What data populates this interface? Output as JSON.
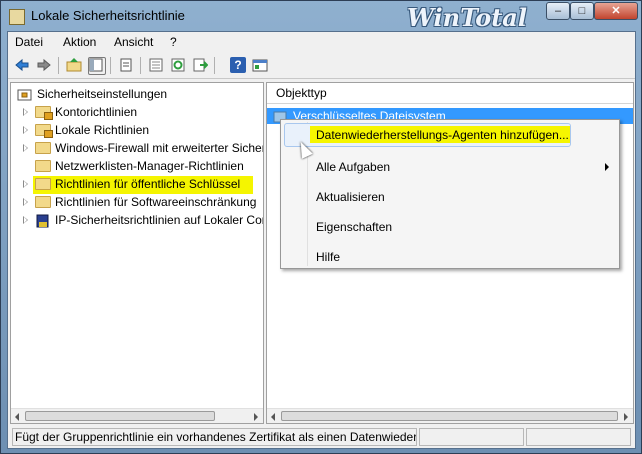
{
  "window": {
    "title": "Lokale Sicherheitsrichtlinie",
    "watermark": "WinTotal",
    "controls": {
      "minimize": "–",
      "maximize": "□",
      "close": "✕"
    }
  },
  "menu": [
    "Datei",
    "Aktion",
    "Ansicht",
    "?"
  ],
  "toolbar": {
    "icons": [
      "back-icon",
      "forward-icon",
      "up-folder-icon",
      "show-tree-icon",
      "properties-icon",
      "export-list-icon",
      "refresh-icon",
      "export-icon",
      "help-icon",
      "console-icon"
    ]
  },
  "tree": {
    "root": "Sicherheitseinstellungen",
    "items": [
      {
        "label": "Kontorichtlinien",
        "icon": "folder-lock-icon",
        "expandable": true
      },
      {
        "label": "Lokale Richtlinien",
        "icon": "folder-lock-icon",
        "expandable": true
      },
      {
        "label": "Windows-Firewall mit erweiterter Sicherheit",
        "icon": "folder-icon",
        "expandable": true
      },
      {
        "label": "Netzwerklisten-Manager-Richtlinien",
        "icon": "folder-icon",
        "expandable": false
      },
      {
        "label": "Richtlinien für öffentliche Schlüssel",
        "icon": "folder-icon",
        "expandable": true,
        "highlighted": true
      },
      {
        "label": "Richtlinien für Softwareeinschränkung",
        "icon": "folder-icon",
        "expandable": true
      },
      {
        "label": "IP-Sicherheitsrichtlinien auf Lokaler Computer",
        "icon": "ipsec-icon",
        "expandable": true
      }
    ]
  },
  "list": {
    "column": "Objekttyp",
    "selected_item": "Verschlüsseltes Dateisystem"
  },
  "context_menu": {
    "items": [
      {
        "label": "Datenwiederherstellungs-Agenten hinzufügen...",
        "highlighted": true
      },
      {
        "label": "Alle Aufgaben",
        "submenu": true
      },
      {
        "label": "Aktualisieren"
      },
      {
        "label": "Eigenschaften"
      },
      {
        "label": "Hilfe"
      }
    ]
  },
  "status": {
    "text": "Fügt der Gruppenrichtlinie ein vorhandenes Zertifikat als einen Datenwiederherstellungs-Agenten hinzu"
  },
  "colors": {
    "highlight": "#f5f500",
    "selection": "#3399ff"
  }
}
